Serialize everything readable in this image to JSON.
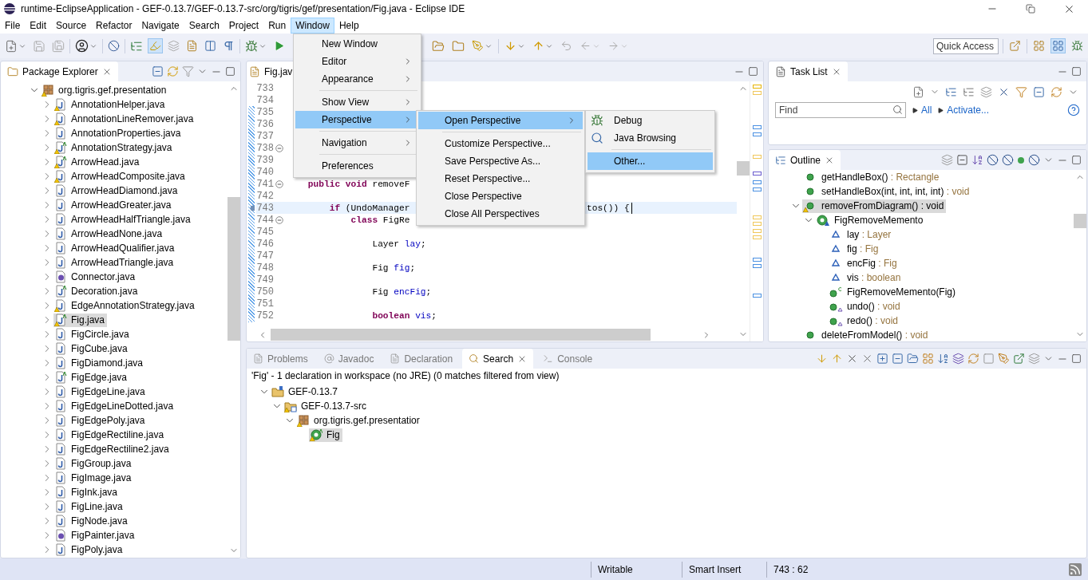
{
  "window": {
    "title": "runtime-EclipseApplication - GEF-0.13.7/GEF-0.13.7-src/org/tigris/gef/presentation/Fig.java - Eclipse IDE"
  },
  "menu_bar": [
    {
      "label": "File",
      "selected": false
    },
    {
      "label": "Edit",
      "selected": false
    },
    {
      "label": "Source",
      "selected": false
    },
    {
      "label": "Refactor",
      "selected": false
    },
    {
      "label": "Navigate",
      "selected": false
    },
    {
      "label": "Search",
      "selected": false
    },
    {
      "label": "Project",
      "selected": false
    },
    {
      "label": "Run",
      "selected": false
    },
    {
      "label": "Window",
      "selected": true
    },
    {
      "label": "Help",
      "selected": false
    }
  ],
  "quick_access": {
    "placeholder": "Quick Access"
  },
  "package_explorer": {
    "title": "Package Explorer",
    "tree": [
      {
        "label": "org.tigris.gef.presentation",
        "kind": "package",
        "warning": true,
        "selected": false,
        "expanded": true,
        "children": [
          {
            "label": "AnnotationHelper.java",
            "kind": "class",
            "warning": true,
            "selected": false,
            "expanded": false
          },
          {
            "label": "AnnotationLineRemover.java",
            "kind": "class",
            "warning": true,
            "selected": false,
            "expanded": false
          },
          {
            "label": "AnnotationProperties.java",
            "kind": "class",
            "warning": false,
            "selected": false,
            "expanded": false
          },
          {
            "label": "AnnotationStrategy.java",
            "kind": "abstract-class",
            "warning": true,
            "selected": false,
            "expanded": false
          },
          {
            "label": "ArrowHead.java",
            "kind": "abstract-class",
            "warning": true,
            "selected": false,
            "expanded": false
          },
          {
            "label": "ArrowHeadComposite.java",
            "kind": "class",
            "warning": true,
            "selected": false,
            "expanded": false
          },
          {
            "label": "ArrowHeadDiamond.java",
            "kind": "class",
            "warning": false,
            "selected": false,
            "expanded": false
          },
          {
            "label": "ArrowHeadGreater.java",
            "kind": "class",
            "warning": false,
            "selected": false,
            "expanded": false
          },
          {
            "label": "ArrowHeadHalfTriangle.java",
            "kind": "class",
            "warning": false,
            "selected": false,
            "expanded": false
          },
          {
            "label": "ArrowHeadNone.java",
            "kind": "class",
            "warning": false,
            "selected": false,
            "expanded": false
          },
          {
            "label": "ArrowHeadQualifier.java",
            "kind": "class",
            "warning": false,
            "selected": false,
            "expanded": false
          },
          {
            "label": "ArrowHeadTriangle.java",
            "kind": "class",
            "warning": false,
            "selected": false,
            "expanded": false
          },
          {
            "label": "Connector.java",
            "kind": "interface",
            "warning": false,
            "selected": false,
            "expanded": false
          },
          {
            "label": "Decoration.java",
            "kind": "abstract-class",
            "warning": false,
            "selected": false,
            "expanded": false
          },
          {
            "label": "EdgeAnnotationStrategy.java",
            "kind": "class",
            "warning": true,
            "selected": false,
            "expanded": false
          },
          {
            "label": "Fig.java",
            "kind": "abstract-class",
            "warning": true,
            "selected": true,
            "expanded": false
          },
          {
            "label": "FigCircle.java",
            "kind": "class",
            "warning": false,
            "selected": false,
            "expanded": false
          },
          {
            "label": "FigCube.java",
            "kind": "class",
            "warning": false,
            "selected": false,
            "expanded": false
          },
          {
            "label": "FigDiamond.java",
            "kind": "class",
            "warning": false,
            "selected": false,
            "expanded": false
          },
          {
            "label": "FigEdge.java",
            "kind": "abstract-class",
            "warning": false,
            "selected": false,
            "expanded": false
          },
          {
            "label": "FigEdgeLine.java",
            "kind": "class",
            "warning": false,
            "selected": false,
            "expanded": false
          },
          {
            "label": "FigEdgeLineDotted.java",
            "kind": "class",
            "warning": false,
            "selected": false,
            "expanded": false
          },
          {
            "label": "FigEdgePoly.java",
            "kind": "class",
            "warning": false,
            "selected": false,
            "expanded": false
          },
          {
            "label": "FigEdgeRectiline.java",
            "kind": "class",
            "warning": false,
            "selected": false,
            "expanded": false
          },
          {
            "label": "FigEdgeRectiline2.java",
            "kind": "class",
            "warning": false,
            "selected": false,
            "expanded": false
          },
          {
            "label": "FigGroup.java",
            "kind": "class",
            "warning": false,
            "selected": false,
            "expanded": false
          },
          {
            "label": "FigImage.java",
            "kind": "class",
            "warning": false,
            "selected": false,
            "expanded": false
          },
          {
            "label": "FigInk.java",
            "kind": "class",
            "warning": false,
            "selected": false,
            "expanded": false
          },
          {
            "label": "FigLine.java",
            "kind": "class",
            "warning": false,
            "selected": false,
            "expanded": false
          },
          {
            "label": "FigNode.java",
            "kind": "class",
            "warning": false,
            "selected": false,
            "expanded": false
          },
          {
            "label": "FigPainter.java",
            "kind": "interface",
            "warning": false,
            "selected": false,
            "expanded": false
          },
          {
            "label": "FigPoly.java",
            "kind": "class",
            "warning": false,
            "selected": false,
            "expanded": false
          }
        ]
      }
    ]
  },
  "editor": {
    "tab": {
      "label": "Fig.jav",
      "selected": true
    },
    "lines": [
      {
        "number": "733",
        "fold": false,
        "current": false,
        "marker": false
      },
      {
        "number": "734",
        "fold": false,
        "current": false,
        "marker": false
      },
      {
        "number": "735",
        "fold": false,
        "current": false,
        "marker": false
      },
      {
        "number": "736",
        "fold": false,
        "current": false,
        "marker": false
      },
      {
        "number": "737",
        "fold": false,
        "current": false,
        "marker": false
      },
      {
        "number": "738",
        "fold": true,
        "current": false,
        "marker": false
      },
      {
        "number": "739",
        "fold": false,
        "current": false,
        "marker": false
      },
      {
        "number": "740",
        "fold": false,
        "current": false,
        "marker": false
      },
      {
        "number": "741",
        "fold": true,
        "current": false,
        "marker": false,
        "parts": [
          {
            "text": "    public void",
            "kind": "keyword"
          },
          {
            "text": " removeF",
            "kind": "plain"
          }
        ]
      },
      {
        "number": "742",
        "fold": false,
        "current": false,
        "marker": false
      },
      {
        "number": "743",
        "fold": false,
        "current": true,
        "marker": true,
        "parts": [
          {
            "text": "        if",
            "kind": "keyword"
          },
          {
            "text": " (UndoManager",
            "kind": "plain"
          }
        ],
        "tail": "tos()) {"
      },
      {
        "number": "744",
        "fold": true,
        "current": false,
        "marker": false,
        "parts": [
          {
            "text": "            class",
            "kind": "keyword"
          },
          {
            "text": " FigRe",
            "kind": "plain"
          }
        ]
      },
      {
        "number": "745",
        "fold": false,
        "current": false,
        "marker": false
      },
      {
        "number": "746",
        "fold": false,
        "current": false,
        "marker": false,
        "parts": [
          {
            "text": "                Layer ",
            "kind": "plain"
          },
          {
            "text": "lay",
            "kind": "field"
          },
          {
            "text": ";",
            "kind": "plain"
          }
        ]
      },
      {
        "number": "747",
        "fold": false,
        "current": false,
        "marker": false
      },
      {
        "number": "748",
        "fold": false,
        "current": false,
        "marker": false,
        "parts": [
          {
            "text": "                Fig ",
            "kind": "plain"
          },
          {
            "text": "fig",
            "kind": "field"
          },
          {
            "text": ";",
            "kind": "plain"
          }
        ]
      },
      {
        "number": "749",
        "fold": false,
        "current": false,
        "marker": false
      },
      {
        "number": "750",
        "fold": false,
        "current": false,
        "marker": false,
        "parts": [
          {
            "text": "                Fig ",
            "kind": "plain"
          },
          {
            "text": "encFig",
            "kind": "field"
          },
          {
            "text": ";",
            "kind": "plain"
          }
        ]
      },
      {
        "number": "751",
        "fold": false,
        "current": false,
        "marker": false
      },
      {
        "number": "752",
        "fold": false,
        "current": false,
        "marker": false,
        "parts": [
          {
            "text": "                boolean",
            "kind": "keyword"
          },
          {
            "text": " vis",
            "kind": "field"
          },
          {
            "text": ";",
            "kind": "plain"
          }
        ]
      }
    ]
  },
  "task_list": {
    "tab": {
      "label": "Task List",
      "selected": true
    },
    "find": {
      "placeholder": "Find"
    },
    "links": [
      "All",
      "Activate..."
    ]
  },
  "outline": {
    "tab": {
      "label": "Outline",
      "selected": true
    },
    "tree": [
      {
        "name": "getHandleBox()",
        "type": ": Rectangle",
        "kind": "method",
        "warning": false,
        "selected": false
      },
      {
        "name": "setHandleBox(int, int, int, int)",
        "type": ": void",
        "kind": "method",
        "warning": false,
        "selected": false
      },
      {
        "name": "removeFromDiagram()",
        "type": ": void",
        "kind": "method",
        "warning": true,
        "selected": true,
        "expanded": true,
        "children": [
          {
            "name": "FigRemoveMemento",
            "kind": "class",
            "warning": false,
            "selected": false,
            "expanded": true,
            "children": [
              {
                "name": "lay",
                "type": ": Layer",
                "kind": "field",
                "warning": false,
                "selected": false
              },
              {
                "name": "fig",
                "type": ": Fig",
                "kind": "field",
                "warning": false,
                "selected": false
              },
              {
                "name": "encFig",
                "type": ": Fig",
                "kind": "field",
                "warning": false,
                "selected": false
              },
              {
                "name": "vis",
                "type": ": boolean",
                "kind": "field",
                "warning": false,
                "selected": false
              },
              {
                "name": "FigRemoveMemento(Fig)",
                "kind": "constructor",
                "warning": false,
                "selected": false
              },
              {
                "name": "undo()",
                "type": ": void",
                "kind": "override",
                "warning": false,
                "selected": false
              },
              {
                "name": "redo()",
                "type": ": void",
                "kind": "override",
                "warning": false,
                "selected": false
              }
            ]
          }
        ]
      },
      {
        "name": "deleteFromModel()",
        "type": ": void",
        "kind": "method",
        "warning": false,
        "selected": false
      }
    ]
  },
  "bottom_panel": {
    "tabs": [
      {
        "label": "Problems",
        "selected": false
      },
      {
        "label": "Javadoc",
        "selected": false
      },
      {
        "label": "Declaration",
        "selected": false
      },
      {
        "label": "Search",
        "selected": true
      },
      {
        "label": "Console",
        "selected": false
      }
    ],
    "summary": "'Fig' - 1 declaration in workspace (no JRE) (0 matches filtered from view)",
    "tree": [
      {
        "label": "GEF-0.13.7",
        "kind": "project",
        "warning": false,
        "selected": false,
        "expanded": true,
        "children": [
          {
            "label": "GEF-0.13.7-src",
            "kind": "source-folder",
            "warning": true,
            "selected": false,
            "expanded": true,
            "children": [
              {
                "label": "org.tigris.gef.presentatior",
                "kind": "package",
                "warning": true,
                "selected": false,
                "expanded": true,
                "children": [
                  {
                    "label": "Fig",
                    "kind": "abstract-class",
                    "warning": true,
                    "selected": true
                  }
                ]
              }
            ]
          }
        ]
      }
    ]
  },
  "window_menu": [
    {
      "kind": "item",
      "label": "New Window",
      "submenu": false,
      "selected": false
    },
    {
      "kind": "item",
      "label": "Editor",
      "submenu": true,
      "selected": false
    },
    {
      "kind": "item",
      "label": "Appearance",
      "submenu": true,
      "selected": false
    },
    {
      "kind": "separator"
    },
    {
      "kind": "item",
      "label": "Show View",
      "submenu": true,
      "selected": false
    },
    {
      "kind": "item",
      "label": "Perspective",
      "submenu": true,
      "selected": true
    },
    {
      "kind": "separator"
    },
    {
      "kind": "item",
      "label": "Navigation",
      "submenu": true,
      "selected": false
    },
    {
      "kind": "separator"
    },
    {
      "kind": "item",
      "label": "Preferences",
      "submenu": false,
      "selected": false
    }
  ],
  "perspective_menu": [
    {
      "kind": "item",
      "label": "Open Perspective",
      "submenu": true,
      "selected": true
    },
    {
      "kind": "separator"
    },
    {
      "kind": "item",
      "label": "Customize Perspective...",
      "submenu": false,
      "selected": false
    },
    {
      "kind": "item",
      "label": "Save Perspective As...",
      "submenu": false,
      "selected": false
    },
    {
      "kind": "item",
      "label": "Reset Perspective...",
      "submenu": false,
      "selected": false
    },
    {
      "kind": "item",
      "label": "Close Perspective",
      "submenu": false,
      "selected": false
    },
    {
      "kind": "item",
      "label": "Close All Perspectives",
      "submenu": false,
      "selected": false
    }
  ],
  "open_perspective_menu": [
    {
      "kind": "debug",
      "label": "Debug",
      "submenu": false,
      "selected": false
    },
    {
      "kind": "browsing",
      "label": "Java Browsing",
      "submenu": false,
      "selected": false
    },
    {
      "kind": "separator"
    },
    {
      "kind": "item",
      "label": "Other...",
      "submenu": false,
      "selected": true
    }
  ],
  "status_bar": [
    "Writable",
    "Smart Insert",
    "743 : 62"
  ]
}
